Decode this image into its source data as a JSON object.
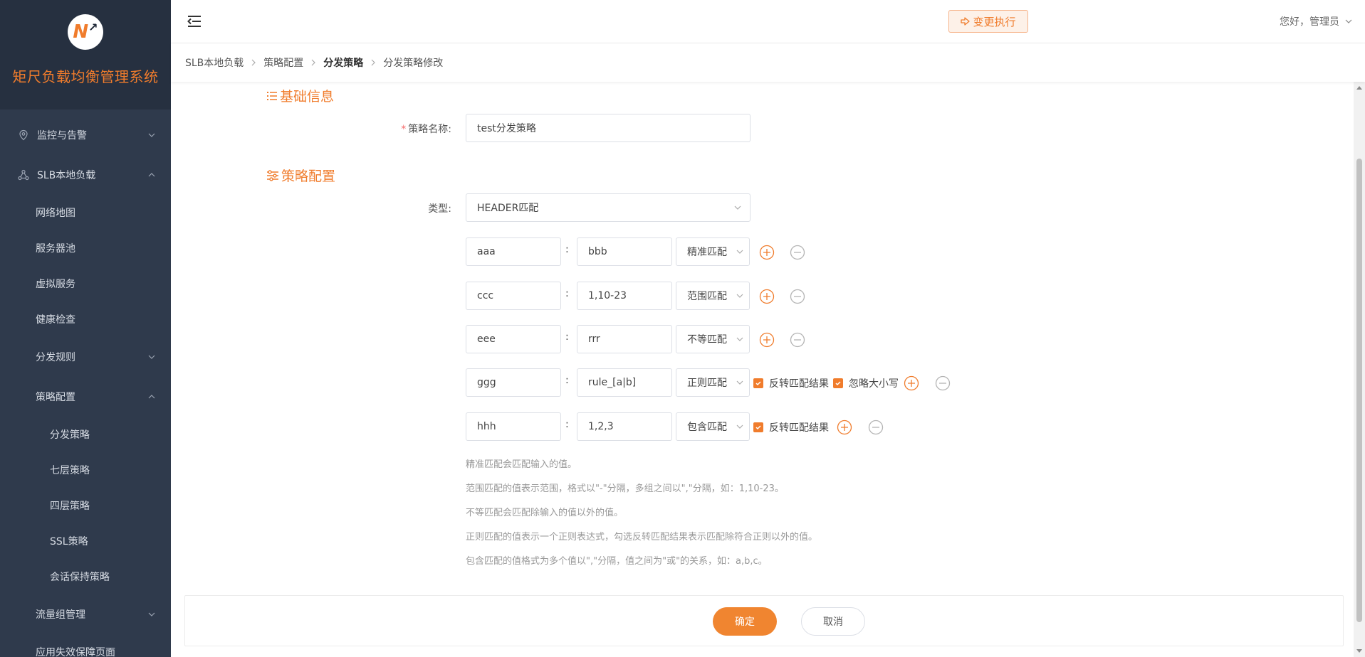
{
  "brand": {
    "logo_text": "N",
    "title": "矩尺负载均衡管理系统"
  },
  "sidebar": {
    "items": [
      {
        "label": "监控与告警",
        "icon": "location-pin-icon",
        "expanded": false
      },
      {
        "label": "SLB本地负载",
        "icon": "network-nodes-icon",
        "expanded": true
      },
      {
        "label": "网络地图"
      },
      {
        "label": "服务器池"
      },
      {
        "label": "虚拟服务"
      },
      {
        "label": "健康检查"
      },
      {
        "label": "分发规则",
        "expanded": false
      },
      {
        "label": "策略配置",
        "expanded": true
      },
      {
        "label": "分发策略"
      },
      {
        "label": "七层策略"
      },
      {
        "label": "四层策略"
      },
      {
        "label": "SSL策略"
      },
      {
        "label": "会话保持策略"
      },
      {
        "label": "流量组管理",
        "expanded": false
      },
      {
        "label": "应用失效保障页面"
      }
    ]
  },
  "header": {
    "exec_label": "变更执行",
    "user_greeting": "您好，管理员"
  },
  "breadcrumb": [
    "SLB本地负载",
    "策略配置",
    "分发策略",
    "分发策略修改"
  ],
  "form": {
    "section_basic": "基础信息",
    "name_label": "策略名称:",
    "name_value": "test分发策略",
    "section_config": "策略配置",
    "type_label": "类型:",
    "type_value": "HEADER匹配",
    "colon": ":",
    "rows": [
      {
        "key": "aaa",
        "value": "bbb",
        "match": "精准匹配"
      },
      {
        "key": "ccc",
        "value": "1,10-23",
        "match": "范围匹配"
      },
      {
        "key": "eee",
        "value": "rrr",
        "match": "不等匹配"
      },
      {
        "key": "ggg",
        "value": "rule_[a|b]",
        "match": "正则匹配",
        "invert_label": "反转匹配结果",
        "ignore_case_label": "忽略大小写"
      },
      {
        "key": "hhh",
        "value": "1,2,3",
        "match": "包含匹配",
        "invert_label": "反转匹配结果"
      }
    ],
    "tips": [
      "精准匹配会匹配输入的值。",
      "范围匹配的值表示范围，格式以\"-\"分隔，多组之间以\",\"分隔，如：1,10-23。",
      "不等匹配会匹配除输入的值以外的值。",
      "正则匹配的值表示一个正则表达式，勾选反转匹配结果表示匹配除符合正则以外的值。",
      "包含匹配的值格式为多个值以\",\"分隔，值之间为\"或\"的关系，如：a,b,c。"
    ]
  },
  "footer": {
    "confirm_label": "确定",
    "cancel_label": "取消"
  },
  "colors": {
    "accent": "#f07c2c",
    "sidebar_bg": "#2f3a4c",
    "brand_bg": "#263040"
  }
}
